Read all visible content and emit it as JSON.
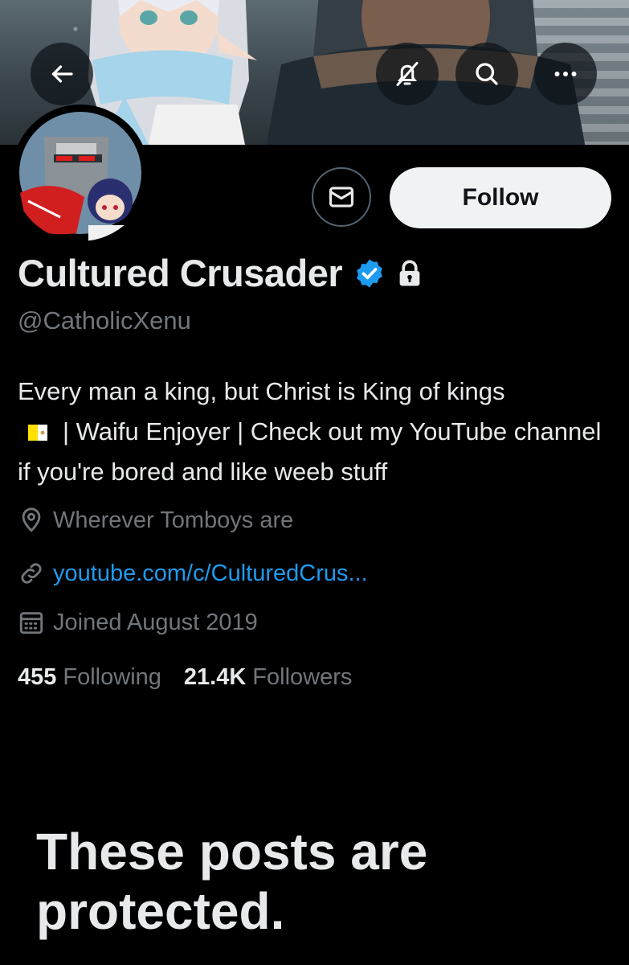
{
  "header": {
    "back_icon": "arrow-left-icon",
    "notifications_icon": "bell-off-icon",
    "search_icon": "search-icon",
    "more_icon": "more-horizontal-icon"
  },
  "profile": {
    "display_name": "Cultured Crusader",
    "handle": "@CatholicXenu",
    "verified": true,
    "protected": true,
    "bio_part1": "Every man a king, but Christ is King of kings",
    "bio_flag": "vatican-flag",
    "bio_part2": "| Waifu Enjoyer | Check out my YouTube channel if you're bored and like weeb stuff",
    "location": "Wherever Tomboys are",
    "website": "youtube.com/c/CulturedCrus...",
    "joined": "Joined August 2019"
  },
  "actions": {
    "message_icon": "envelope-icon",
    "follow_label": "Follow"
  },
  "stats": {
    "following_count": "455",
    "following_label": "Following",
    "followers_count": "21.4K",
    "followers_label": "Followers"
  },
  "protected_message": "These posts are protected.",
  "colors": {
    "background": "#000000",
    "text_primary": "#e7e9ea",
    "text_secondary": "#71767b",
    "link": "#1d9bf0",
    "verified": "#1d9bf0",
    "follow_button_bg": "#eff3f4"
  }
}
